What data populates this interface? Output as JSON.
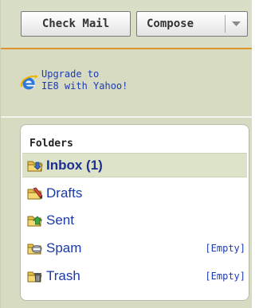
{
  "toolbar": {
    "check_mail_label": "Check Mail",
    "compose_label": "Compose"
  },
  "promo": {
    "line1": "Upgrade to",
    "line2": "IE8 with Yahoo!",
    "icon": "internet-explorer-icon"
  },
  "folders": {
    "title": "Folders",
    "items": [
      {
        "label": "Inbox (1)",
        "icon": "inbox-icon",
        "selected": true,
        "action": ""
      },
      {
        "label": "Drafts",
        "icon": "drafts-icon",
        "selected": false,
        "action": ""
      },
      {
        "label": "Sent",
        "icon": "sent-icon",
        "selected": false,
        "action": ""
      },
      {
        "label": "Spam",
        "icon": "spam-icon",
        "selected": false,
        "action": "Empty"
      },
      {
        "label": "Trash",
        "icon": "trash-icon",
        "selected": false,
        "action": "Empty"
      }
    ]
  },
  "colors": {
    "sidebar_bg": "#d6dbc2",
    "accent_orange": "#e0952a",
    "link_blue": "#1d3bb3",
    "selected_bg": "#dde3c8"
  }
}
